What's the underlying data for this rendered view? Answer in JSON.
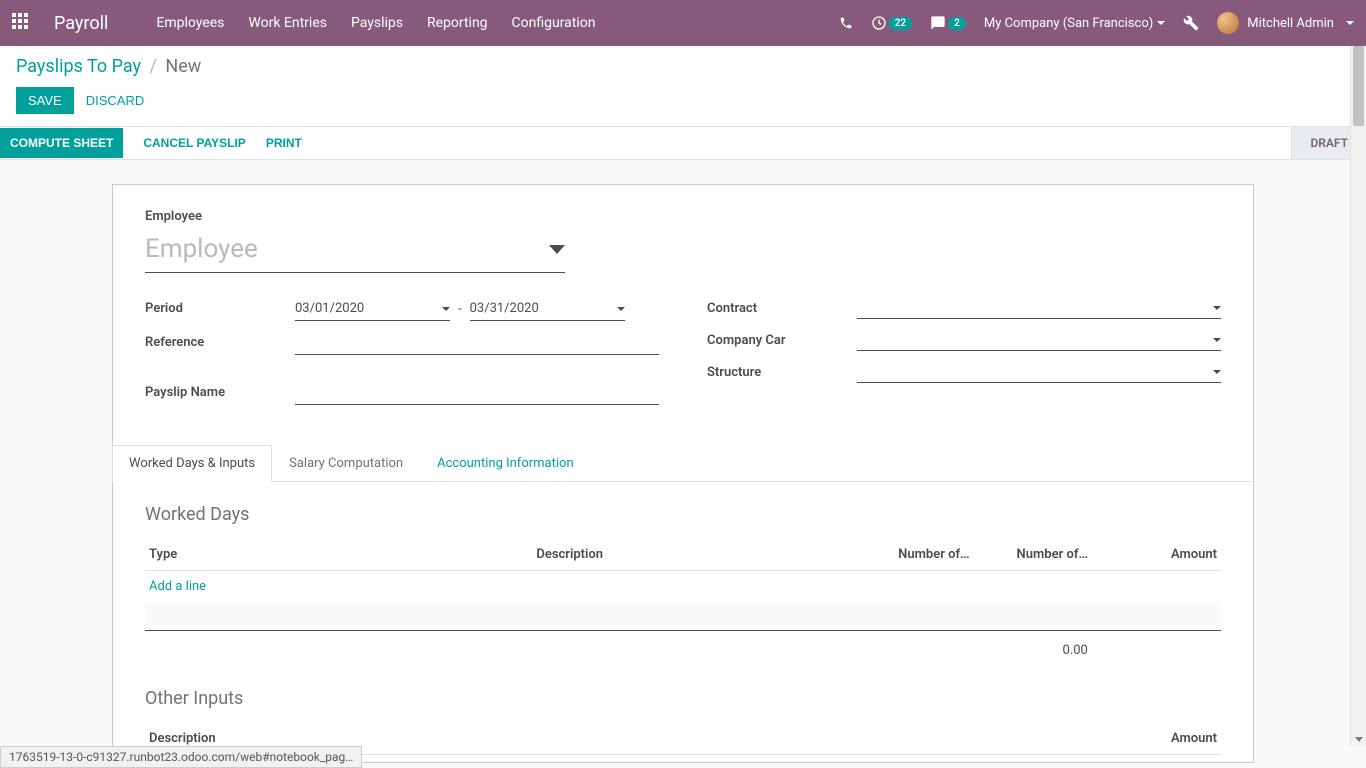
{
  "navbar": {
    "brand": "Payroll",
    "menu": [
      "Employees",
      "Work Entries",
      "Payslips",
      "Reporting",
      "Configuration"
    ],
    "activities_count": "22",
    "messages_count": "2",
    "company": "My Company (San Francisco)",
    "user": "Mitchell Admin"
  },
  "breadcrumb": {
    "parent": "Payslips To Pay",
    "current": "New"
  },
  "buttons": {
    "save": "SAVE",
    "discard": "DISCARD",
    "compute": "COMPUTE SHEET",
    "cancel": "CANCEL PAYSLIP",
    "print": "PRINT"
  },
  "status": "DRAFT",
  "form": {
    "employee_label": "Employee",
    "employee_placeholder": "Employee",
    "period_label": "Period",
    "date_from": "03/01/2020",
    "date_to": "03/31/2020",
    "date_sep": "-",
    "reference_label": "Reference",
    "payslip_name_label": "Payslip Name",
    "contract_label": "Contract",
    "company_car_label": "Company Car",
    "structure_label": "Structure"
  },
  "tabs": {
    "worked": "Worked Days & Inputs",
    "salary": "Salary Computation",
    "accounting": "Accounting Information"
  },
  "worked_days": {
    "title": "Worked Days",
    "col_type": "Type",
    "col_desc": "Description",
    "col_days": "Number of…",
    "col_hours": "Number of…",
    "col_amount": "Amount",
    "add_line": "Add a line",
    "total": "0.00"
  },
  "other_inputs": {
    "title": "Other Inputs",
    "col_desc": "Description",
    "col_amount": "Amount"
  },
  "url": "1763519-13-0-c91327.runbot23.odoo.com/web#notebook_pag…"
}
